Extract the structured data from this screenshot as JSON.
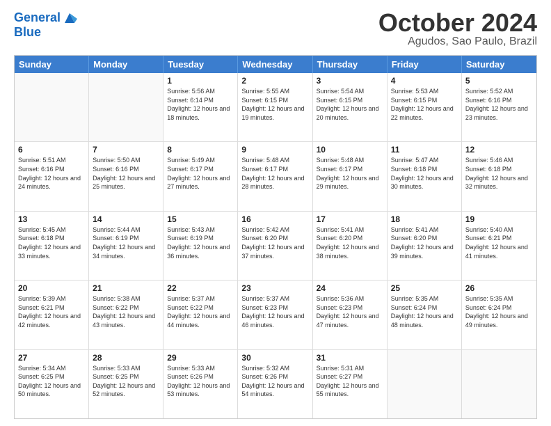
{
  "header": {
    "logo_line1": "General",
    "logo_line2": "Blue",
    "month": "October 2024",
    "location": "Agudos, Sao Paulo, Brazil"
  },
  "days_of_week": [
    "Sunday",
    "Monday",
    "Tuesday",
    "Wednesday",
    "Thursday",
    "Friday",
    "Saturday"
  ],
  "weeks": [
    [
      {
        "day": "",
        "sunrise": "",
        "sunset": "",
        "daylight": ""
      },
      {
        "day": "",
        "sunrise": "",
        "sunset": "",
        "daylight": ""
      },
      {
        "day": "1",
        "sunrise": "Sunrise: 5:56 AM",
        "sunset": "Sunset: 6:14 PM",
        "daylight": "Daylight: 12 hours and 18 minutes."
      },
      {
        "day": "2",
        "sunrise": "Sunrise: 5:55 AM",
        "sunset": "Sunset: 6:15 PM",
        "daylight": "Daylight: 12 hours and 19 minutes."
      },
      {
        "day": "3",
        "sunrise": "Sunrise: 5:54 AM",
        "sunset": "Sunset: 6:15 PM",
        "daylight": "Daylight: 12 hours and 20 minutes."
      },
      {
        "day": "4",
        "sunrise": "Sunrise: 5:53 AM",
        "sunset": "Sunset: 6:15 PM",
        "daylight": "Daylight: 12 hours and 22 minutes."
      },
      {
        "day": "5",
        "sunrise": "Sunrise: 5:52 AM",
        "sunset": "Sunset: 6:16 PM",
        "daylight": "Daylight: 12 hours and 23 minutes."
      }
    ],
    [
      {
        "day": "6",
        "sunrise": "Sunrise: 5:51 AM",
        "sunset": "Sunset: 6:16 PM",
        "daylight": "Daylight: 12 hours and 24 minutes."
      },
      {
        "day": "7",
        "sunrise": "Sunrise: 5:50 AM",
        "sunset": "Sunset: 6:16 PM",
        "daylight": "Daylight: 12 hours and 25 minutes."
      },
      {
        "day": "8",
        "sunrise": "Sunrise: 5:49 AM",
        "sunset": "Sunset: 6:17 PM",
        "daylight": "Daylight: 12 hours and 27 minutes."
      },
      {
        "day": "9",
        "sunrise": "Sunrise: 5:48 AM",
        "sunset": "Sunset: 6:17 PM",
        "daylight": "Daylight: 12 hours and 28 minutes."
      },
      {
        "day": "10",
        "sunrise": "Sunrise: 5:48 AM",
        "sunset": "Sunset: 6:17 PM",
        "daylight": "Daylight: 12 hours and 29 minutes."
      },
      {
        "day": "11",
        "sunrise": "Sunrise: 5:47 AM",
        "sunset": "Sunset: 6:18 PM",
        "daylight": "Daylight: 12 hours and 30 minutes."
      },
      {
        "day": "12",
        "sunrise": "Sunrise: 5:46 AM",
        "sunset": "Sunset: 6:18 PM",
        "daylight": "Daylight: 12 hours and 32 minutes."
      }
    ],
    [
      {
        "day": "13",
        "sunrise": "Sunrise: 5:45 AM",
        "sunset": "Sunset: 6:18 PM",
        "daylight": "Daylight: 12 hours and 33 minutes."
      },
      {
        "day": "14",
        "sunrise": "Sunrise: 5:44 AM",
        "sunset": "Sunset: 6:19 PM",
        "daylight": "Daylight: 12 hours and 34 minutes."
      },
      {
        "day": "15",
        "sunrise": "Sunrise: 5:43 AM",
        "sunset": "Sunset: 6:19 PM",
        "daylight": "Daylight: 12 hours and 36 minutes."
      },
      {
        "day": "16",
        "sunrise": "Sunrise: 5:42 AM",
        "sunset": "Sunset: 6:20 PM",
        "daylight": "Daylight: 12 hours and 37 minutes."
      },
      {
        "day": "17",
        "sunrise": "Sunrise: 5:41 AM",
        "sunset": "Sunset: 6:20 PM",
        "daylight": "Daylight: 12 hours and 38 minutes."
      },
      {
        "day": "18",
        "sunrise": "Sunrise: 5:41 AM",
        "sunset": "Sunset: 6:20 PM",
        "daylight": "Daylight: 12 hours and 39 minutes."
      },
      {
        "day": "19",
        "sunrise": "Sunrise: 5:40 AM",
        "sunset": "Sunset: 6:21 PM",
        "daylight": "Daylight: 12 hours and 41 minutes."
      }
    ],
    [
      {
        "day": "20",
        "sunrise": "Sunrise: 5:39 AM",
        "sunset": "Sunset: 6:21 PM",
        "daylight": "Daylight: 12 hours and 42 minutes."
      },
      {
        "day": "21",
        "sunrise": "Sunrise: 5:38 AM",
        "sunset": "Sunset: 6:22 PM",
        "daylight": "Daylight: 12 hours and 43 minutes."
      },
      {
        "day": "22",
        "sunrise": "Sunrise: 5:37 AM",
        "sunset": "Sunset: 6:22 PM",
        "daylight": "Daylight: 12 hours and 44 minutes."
      },
      {
        "day": "23",
        "sunrise": "Sunrise: 5:37 AM",
        "sunset": "Sunset: 6:23 PM",
        "daylight": "Daylight: 12 hours and 46 minutes."
      },
      {
        "day": "24",
        "sunrise": "Sunrise: 5:36 AM",
        "sunset": "Sunset: 6:23 PM",
        "daylight": "Daylight: 12 hours and 47 minutes."
      },
      {
        "day": "25",
        "sunrise": "Sunrise: 5:35 AM",
        "sunset": "Sunset: 6:24 PM",
        "daylight": "Daylight: 12 hours and 48 minutes."
      },
      {
        "day": "26",
        "sunrise": "Sunrise: 5:35 AM",
        "sunset": "Sunset: 6:24 PM",
        "daylight": "Daylight: 12 hours and 49 minutes."
      }
    ],
    [
      {
        "day": "27",
        "sunrise": "Sunrise: 5:34 AM",
        "sunset": "Sunset: 6:25 PM",
        "daylight": "Daylight: 12 hours and 50 minutes."
      },
      {
        "day": "28",
        "sunrise": "Sunrise: 5:33 AM",
        "sunset": "Sunset: 6:25 PM",
        "daylight": "Daylight: 12 hours and 52 minutes."
      },
      {
        "day": "29",
        "sunrise": "Sunrise: 5:33 AM",
        "sunset": "Sunset: 6:26 PM",
        "daylight": "Daylight: 12 hours and 53 minutes."
      },
      {
        "day": "30",
        "sunrise": "Sunrise: 5:32 AM",
        "sunset": "Sunset: 6:26 PM",
        "daylight": "Daylight: 12 hours and 54 minutes."
      },
      {
        "day": "31",
        "sunrise": "Sunrise: 5:31 AM",
        "sunset": "Sunset: 6:27 PM",
        "daylight": "Daylight: 12 hours and 55 minutes."
      },
      {
        "day": "",
        "sunrise": "",
        "sunset": "",
        "daylight": ""
      },
      {
        "day": "",
        "sunrise": "",
        "sunset": "",
        "daylight": ""
      }
    ]
  ]
}
